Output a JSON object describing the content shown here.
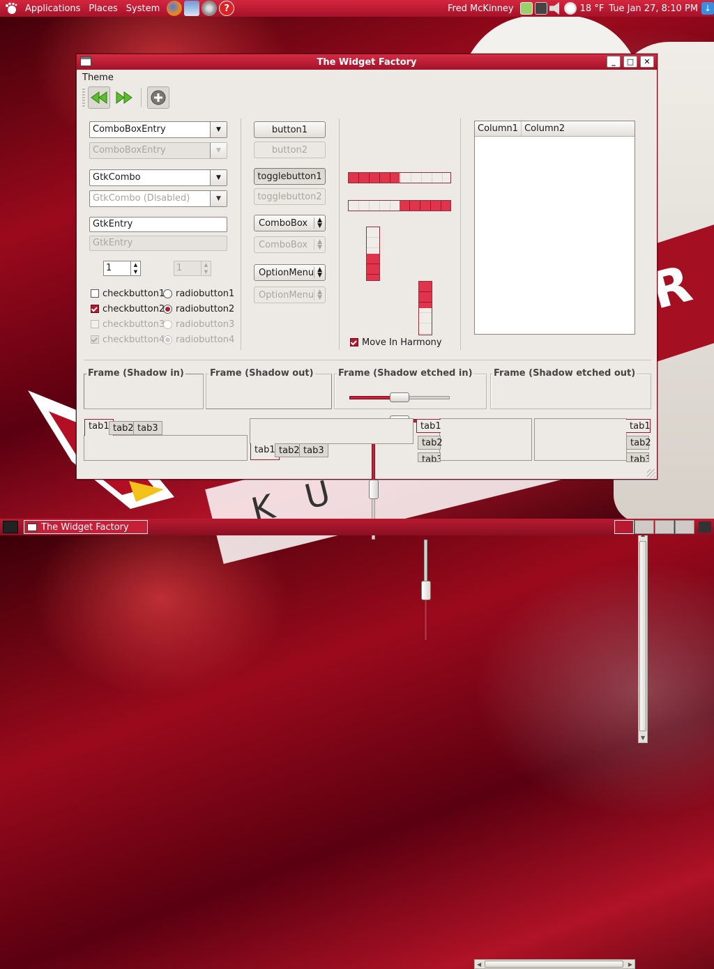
{
  "panel": {
    "menus": [
      "Applications",
      "Places",
      "System"
    ],
    "user": "Fred McKinney",
    "temperature": "18 °F",
    "datetime": "Tue Jan 27,  8:10 PM"
  },
  "window": {
    "title": "The Widget Factory",
    "menu_theme": "Theme",
    "combo_entry": "ComboBoxEntry",
    "combo_entry_disabled": "ComboBoxEntry",
    "gtk_combo": "GtkCombo",
    "gtk_combo_disabled": "GtkCombo (Disabled)",
    "gtk_entry": "GtkEntry",
    "gtk_entry_disabled_placeholder": "GtkEntry",
    "spin_value": "1",
    "spin_disabled_value": "1",
    "checks": [
      "checkbutton1",
      "checkbutton2",
      "checkbutton3",
      "checkbutton4"
    ],
    "radios": [
      "radiobutton1",
      "radiobutton2",
      "radiobutton3",
      "radiobutton4"
    ],
    "button1": "button1",
    "button2": "button2",
    "toggle1": "togglebutton1",
    "toggle2": "togglebutton2",
    "combobox": "ComboBox",
    "combobox_disabled": "ComboBox",
    "optionmenu": "OptionMenu",
    "optionmenu_disabled": "OptionMenu",
    "move_in_harmony": "Move In Harmony",
    "columns": [
      "Column1",
      "Column2"
    ],
    "frames": [
      "Frame (Shadow in)",
      "Frame (Shadow out)",
      "Frame (Shadow etched in)",
      "Frame (Shadow etched out)"
    ],
    "tabs": [
      "tab1",
      "tab2",
      "tab3"
    ]
  },
  "levels": {
    "hprogress1": 0.5,
    "hprogress2": 0.5,
    "vprogress1": 0.5,
    "vprogress2": 0.5,
    "hscale1": 0.5,
    "hscale2": 0.5,
    "vscale1": 0.5,
    "vscale2": 0.5
  },
  "taskbar": {
    "task_title": "The Widget Factory"
  },
  "colors": {
    "accent": "#b3192f",
    "panel": "#c21e36",
    "window_bg": "#edeae5"
  }
}
